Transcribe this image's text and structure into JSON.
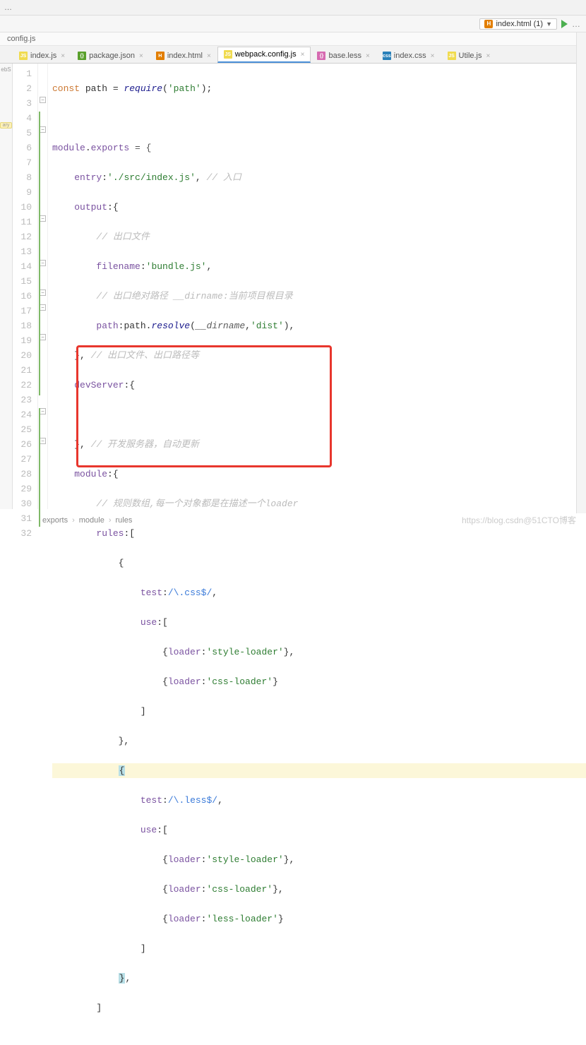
{
  "run_config": "index.html (1)",
  "tab_path": "config.js",
  "side_label": "ebS",
  "side_pill": "ary",
  "tabs": [
    {
      "type": "js",
      "label": "index.js"
    },
    {
      "type": "json",
      "label": "package.json"
    },
    {
      "type": "html",
      "label": "index.html"
    },
    {
      "type": "js",
      "label": "webpack.config.js",
      "active": true
    },
    {
      "type": "less",
      "label": "base.less"
    },
    {
      "type": "css",
      "label": "index.css"
    },
    {
      "type": "js",
      "label": "Utile.js"
    }
  ],
  "breadcrumb": [
    "exports",
    "module",
    "rules"
  ],
  "watermark": "https://blog.csdn@51CTO博客",
  "code": {
    "l1": {
      "const": "const",
      "path": "path",
      "op": " = ",
      "req": "require",
      "paren": "(",
      "str": "'path'",
      "end": ");"
    },
    "l3": {
      "mod": "module",
      "dot": ".",
      "exp": "exports",
      "op": " = {"
    },
    "l4": {
      "k": "entry",
      "v": "'./src/index.js'",
      "c": "// 入口"
    },
    "l5": {
      "k": "output",
      "v": ":{"
    },
    "l6": {
      "c": "// 出口文件"
    },
    "l7": {
      "k": "filename",
      "v": "'bundle.js'",
      "end": ","
    },
    "l8": {
      "c": "// 出口绝对路径 __dirname:当前项目根目录"
    },
    "l9": {
      "k": "path",
      "call": "path",
      "m": "resolve",
      "arg1": "__dirname",
      "arg2": "'dist'",
      "end": "),"
    },
    "l10": {
      "close": "},",
      "c": "// 出口文件、出口路径等"
    },
    "l11": {
      "k": "devServer",
      "v": ":{"
    },
    "l13": {
      "close": "},",
      "c": "// 开发服务器，自动更新"
    },
    "l14": {
      "k": "module",
      "v": ":{"
    },
    "l15": {
      "c": "// 规则数组,每一个对象都是在描述一个loader"
    },
    "l16": {
      "k": "rules",
      "v": ":["
    },
    "l17": {
      "open": "{"
    },
    "l18": {
      "k": "test",
      "re": "/\\.css$/",
      "end": ","
    },
    "l19": {
      "k": "use",
      "v": ":["
    },
    "l20": {
      "k": "loader",
      "v": "'style-loader'",
      "end": "},"
    },
    "l21": {
      "k": "loader",
      "v": "'css-loader'",
      "end": "}"
    },
    "l22": {
      "close": "]"
    },
    "l23": {
      "close": "},"
    },
    "l24": {
      "brace": "{"
    },
    "l25": {
      "k": "test",
      "re": "/\\.less$/",
      "end": ","
    },
    "l26": {
      "k": "use",
      "v": ":["
    },
    "l27": {
      "k": "loader",
      "v": "'style-loader'",
      "end": "},"
    },
    "l28": {
      "k": "loader",
      "v": "'css-loader'",
      "end": "},"
    },
    "l29": {
      "k": "loader",
      "v": "'less-loader'",
      "end": "}"
    },
    "l30": {
      "close": "]"
    },
    "l31": {
      "brace": "}",
      "end": ","
    },
    "l32": {
      "close": "]"
    }
  }
}
